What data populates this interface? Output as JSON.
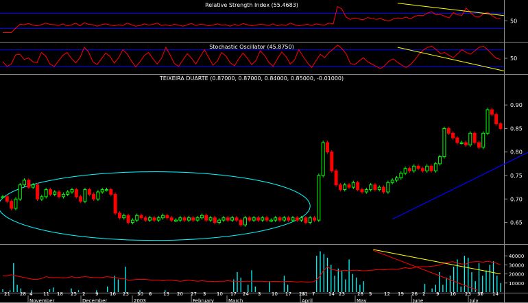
{
  "chart_data": [
    {
      "type": "line",
      "title": "Relative Strength Index (55.4683)",
      "ylim": [
        0,
        100
      ],
      "y_ticks": [
        {
          "value": 50,
          "label": "50"
        }
      ],
      "bands": [
        30,
        70
      ],
      "series": [
        {
          "name": "RSI",
          "color": "#ff0000",
          "values": [
            19,
            19,
            19,
            31,
            41,
            40,
            43,
            39,
            37,
            40,
            44,
            41,
            40,
            38,
            42,
            37,
            39,
            44,
            37,
            45,
            41,
            40,
            36,
            40,
            42,
            39,
            37,
            40,
            38,
            44,
            40,
            36,
            38,
            42,
            39,
            41,
            44,
            38,
            40,
            37,
            41,
            39,
            36,
            40,
            43,
            38,
            41,
            40,
            37,
            39,
            42,
            39,
            40,
            36,
            41,
            38,
            43,
            40,
            37,
            39,
            41,
            40,
            38,
            42,
            37,
            40,
            38,
            44,
            40,
            37,
            39,
            41,
            38,
            42,
            40,
            39,
            44,
            42,
            88,
            82,
            60,
            54,
            58,
            55,
            53,
            59,
            57,
            54,
            56,
            52,
            50,
            55,
            58,
            57,
            60,
            55,
            62,
            65,
            64,
            71,
            74,
            66,
            67,
            62,
            58,
            72,
            66,
            65,
            84,
            72,
            62,
            60,
            69,
            73,
            64,
            57,
            55
          ]
        }
      ],
      "trendlines": [
        {
          "color": "#ffff00",
          "x": [
            92,
            122
          ],
          "y": [
            97,
            64
          ]
        }
      ],
      "value_label": "55.4683"
    },
    {
      "type": "line",
      "title": "Stochastic Oscillator (45.8750)",
      "ylim": [
        0,
        100
      ],
      "y_ticks": [
        {
          "value": 50,
          "label": "50"
        }
      ],
      "bands": [
        20,
        80
      ],
      "series": [
        {
          "name": "Stochastic",
          "color": "#ff0000",
          "values": [
            38,
            22,
            30,
            62,
            64,
            46,
            51,
            38,
            35,
            70,
            58,
            30,
            22,
            41,
            60,
            70,
            50,
            34,
            52,
            88,
            72,
            38,
            28,
            48,
            68,
            56,
            33,
            52,
            80,
            65,
            40,
            20,
            38,
            60,
            70,
            48,
            30,
            50,
            88,
            62,
            32,
            22,
            45,
            66,
            50,
            30,
            55,
            80,
            52,
            26,
            40,
            70,
            58,
            34,
            24,
            48,
            68,
            50,
            28,
            42,
            76,
            60,
            36,
            22,
            48,
            72,
            56,
            30,
            44,
            80,
            56,
            34,
            18,
            42,
            64,
            52,
            70,
            82,
            96,
            84,
            66,
            32,
            28,
            40,
            52,
            38,
            30,
            22,
            14,
            24,
            40,
            48,
            36,
            26,
            18,
            28,
            44,
            64,
            78,
            88,
            92,
            80,
            66,
            70,
            60,
            52,
            66,
            80,
            70,
            64,
            76,
            88,
            92,
            80,
            64,
            50,
            46
          ]
        }
      ],
      "trendlines": [
        {
          "color": "#ffff00",
          "x": [
            92,
            122
          ],
          "y": [
            88,
            6
          ]
        }
      ],
      "value_label": "45.8750"
    },
    {
      "type": "candlestick",
      "title": "TEIXEIRA DUARTE (0.87000, 0.87000, 0.84000, 0.85000, -0.01000)",
      "ylim": [
        0.61,
        0.96
      ],
      "y_ticks": [
        0.65,
        0.7,
        0.75,
        0.8,
        0.85,
        0.9
      ],
      "y_tick_labels": [
        "0.65",
        "0.70",
        "0.75",
        "0.80",
        "0.85",
        "0.90"
      ],
      "close": [
        0.705,
        0.695,
        0.68,
        0.7,
        0.73,
        0.74,
        0.725,
        0.73,
        0.7,
        0.705,
        0.72,
        0.71,
        0.715,
        0.705,
        0.71,
        0.715,
        0.72,
        0.705,
        0.695,
        0.72,
        0.71,
        0.7,
        0.715,
        0.72,
        0.72,
        0.71,
        0.67,
        0.66,
        0.665,
        0.65,
        0.655,
        0.665,
        0.66,
        0.655,
        0.66,
        0.655,
        0.66,
        0.665,
        0.66,
        0.655,
        0.655,
        0.66,
        0.655,
        0.66,
        0.655,
        0.66,
        0.665,
        0.655,
        0.66,
        0.65,
        0.655,
        0.66,
        0.655,
        0.66,
        0.655,
        0.645,
        0.66,
        0.655,
        0.66,
        0.655,
        0.66,
        0.655,
        0.655,
        0.66,
        0.655,
        0.66,
        0.655,
        0.66,
        0.655,
        0.66,
        0.65,
        0.66,
        0.655,
        0.75,
        0.82,
        0.8,
        0.76,
        0.73,
        0.72,
        0.73,
        0.725,
        0.735,
        0.72,
        0.715,
        0.72,
        0.73,
        0.72,
        0.725,
        0.715,
        0.735,
        0.74,
        0.745,
        0.755,
        0.765,
        0.76,
        0.77,
        0.765,
        0.76,
        0.77,
        0.76,
        0.775,
        0.79,
        0.85,
        0.84,
        0.83,
        0.82,
        0.82,
        0.815,
        0.84,
        0.82,
        0.81,
        0.84,
        0.89,
        0.88,
        0.86,
        0.85
      ],
      "candle_colors": {
        "up": "#00ff00",
        "down": "#ff0000"
      },
      "trendline": {
        "color": "#0000ff",
        "x": [
          90,
          127
        ],
        "y": [
          0.657,
          0.825
        ]
      },
      "ellipse": {
        "color": "#00ffff",
        "cx": 35,
        "cy": 0.685,
        "rx": 36,
        "ry": 0.073
      }
    },
    {
      "type": "bar",
      "title": "",
      "ylim": [
        0,
        50000
      ],
      "y_ticks": [
        10000,
        20000,
        30000,
        40000
      ],
      "y_tick_labels": [
        "10000",
        "20000",
        "30000",
        "40000"
      ],
      "bar_color": "#00ffff",
      "values": [
        3000,
        0,
        2000,
        32000,
        8000,
        4000,
        0,
        0,
        2000,
        0,
        0,
        0,
        0,
        3000,
        5000,
        0,
        0,
        0,
        0,
        4000,
        0,
        2000,
        0,
        0,
        0,
        0,
        2000,
        0,
        0,
        6000,
        0,
        18000,
        14000,
        0,
        28000,
        0,
        0,
        0,
        2000,
        0,
        0,
        0,
        0,
        0,
        0,
        2000,
        0,
        0,
        0,
        0,
        0,
        0,
        0,
        0,
        0,
        0,
        0,
        0,
        0,
        0,
        0,
        0,
        0,
        0,
        14000,
        22000,
        16000,
        0,
        8000,
        24000,
        6000,
        0,
        0,
        0,
        12000,
        0,
        0,
        0,
        18000,
        8000,
        0,
        0,
        0,
        0,
        0,
        0,
        0,
        40000,
        45000,
        42000,
        38000,
        30000,
        18000,
        26000,
        24000,
        14000,
        36000,
        20000,
        16000,
        8000,
        12000,
        0,
        0,
        0,
        0,
        0,
        0,
        0,
        0,
        0,
        0,
        0,
        0,
        0,
        0,
        0,
        0,
        9000,
        0,
        4000,
        8000,
        22000,
        8000,
        16000,
        18000,
        28000,
        36000,
        6000,
        40000,
        38000,
        22000,
        12000,
        32000,
        18000,
        24000,
        30000,
        34000,
        18000,
        10000
      ],
      "overlay": {
        "color": "#ff0000",
        "values": [
          18000,
          18000,
          19000,
          18000,
          17000,
          16000,
          15000,
          14000,
          14000,
          15000,
          17000,
          16000,
          16000,
          16000,
          15500,
          16000,
          17000,
          16000,
          16500,
          17000,
          16500,
          16000,
          16000,
          16000,
          17000,
          16500,
          16000,
          15000,
          15000,
          13000,
          13500,
          14000,
          14000,
          14000,
          13500,
          13000,
          13000,
          12500,
          13000,
          13000,
          12500,
          12000,
          12500,
          13000,
          12500,
          12000,
          12500,
          12000,
          12000,
          11500,
          12000,
          12000,
          12500,
          12000,
          12000,
          11500,
          12000,
          12000,
          12000,
          12000,
          12000,
          11500,
          11500,
          12000,
          11500,
          11500,
          12000,
          11500,
          11000,
          11500,
          11000,
          11000,
          11500,
          16000,
          23000,
          28000,
          25000,
          24000,
          23000,
          24000,
          23500,
          24000,
          24000,
          23500,
          23500,
          24000,
          24500,
          25000,
          24500,
          25000,
          25500,
          25000,
          26000,
          27000,
          26000,
          27000,
          28000,
          28000,
          28000,
          28500,
          29000,
          30000,
          32000,
          33000,
          33500,
          32000,
          31000,
          31000,
          33000,
          33500,
          33500,
          33000,
          34000,
          33000,
          32000,
          30000
        ]
      },
      "trendlines": [
        {
          "color": "#ff0000",
          "x": [
            96,
            123
          ],
          "y": [
            46000,
            2000
          ]
        },
        {
          "color": "#ffff00",
          "x": [
            96,
            129
          ],
          "y": [
            47000,
            20000
          ]
        }
      ]
    }
  ],
  "x_axis": {
    "day_labels": [
      "21",
      "28",
      "4",
      "11",
      "18",
      "25",
      "2",
      "9",
      "16",
      "23",
      "30",
      "6",
      "13",
      "20",
      "27",
      "3",
      "10",
      "17",
      "24",
      "3",
      "10",
      "17",
      "24",
      "31",
      "7",
      "14",
      "23",
      "28",
      "5",
      "12",
      "19",
      "26",
      "2",
      "9",
      "16",
      "23",
      "30",
      "7",
      "14"
    ],
    "month_labels": [
      "November",
      "December",
      "2003",
      "February",
      "March",
      "April",
      "May",
      "June",
      "July"
    ]
  }
}
